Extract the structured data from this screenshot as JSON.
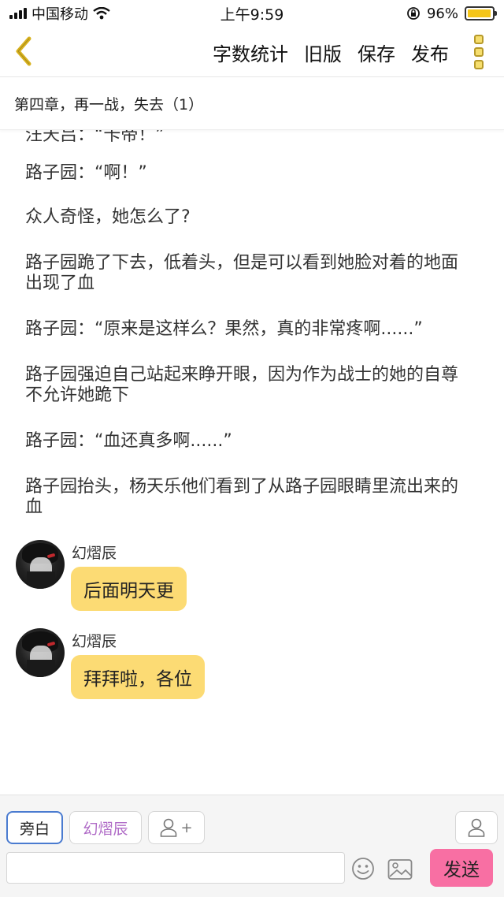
{
  "status_bar": {
    "carrier": "中国移动",
    "time": "上午9:59",
    "battery": "96%",
    "battery_level": 0.96
  },
  "nav": {
    "back_icon": "chevron-left-icon",
    "actions": [
      "字数统计",
      "旧版",
      "保存",
      "发布"
    ],
    "more_icon": "more-icon"
  },
  "chapter": {
    "title": "第四章，再一战，失去（1）"
  },
  "content": {
    "clipped_line": "汪天吕：“卡帝！”",
    "narrations": [
      "路子园：“啊！”",
      "众人奇怪，她怎么了?",
      "路子园跪了下去，低着头，但是可以看到她脸对着的地面出现了血",
      "路子园：“原来是这样么？果然，真的非常疼啊......”",
      "路子园强迫自己站起来睁开眼，因为作为战士的她的自尊不允许她跪下",
      "路子园：“血还真多啊......”",
      "路子园抬头，杨天乐他们看到了从路子园眼睛里流出来的血"
    ],
    "messages": [
      {
        "name": "幻熠辰",
        "text": "后面明天更"
      },
      {
        "name": "幻熠辰",
        "text": "拜拜啦，各位"
      }
    ]
  },
  "input_bar": {
    "role_narration": "旁白",
    "role_character": "幻熠辰",
    "add_role_symbol": "+",
    "input_value": "",
    "input_placeholder": "",
    "send_label": "发送",
    "accent_send": "#f86fa3",
    "accent_bubble": "#fcdb74"
  }
}
